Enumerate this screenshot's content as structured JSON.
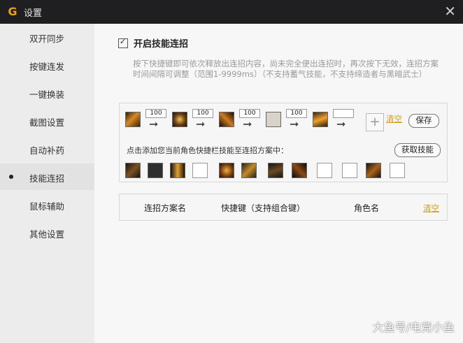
{
  "window": {
    "title": "设置",
    "close_glyph": "✕",
    "logo_glyph": "G"
  },
  "sidebar": {
    "items": [
      {
        "label": "双开同步"
      },
      {
        "label": "按键连发"
      },
      {
        "label": "一键换装"
      },
      {
        "label": "截图设置"
      },
      {
        "label": "自动补药"
      },
      {
        "label": "技能连招",
        "active": true
      },
      {
        "label": "鼠标辅助"
      },
      {
        "label": "其他设置"
      }
    ]
  },
  "main": {
    "enable_label": "开启技能连招",
    "enable_checked": true,
    "description": "按下快捷键即可依次释放出连招内容，尚未完全便出连招时，再次按下无效，连招方案时间间隔可调整（范围1-9999ms）（不支持蓄气技能，不支持缔造者与黑暗武士）",
    "sequence": {
      "delays": [
        "100",
        "100",
        "100",
        "100",
        ""
      ],
      "arrow_glyph": "➞",
      "plus_glyph": "+",
      "clear_label": "清空",
      "save_label": "保存"
    },
    "palette": {
      "hint": "点击添加您当前角色快捷栏技能至连招方案中：",
      "fetch_label": "获取技能"
    },
    "table": {
      "col_plan": "连招方案名",
      "col_hotkey": "快捷键（支持组合键）",
      "col_role": "角色名",
      "clear_label": "清空"
    }
  },
  "watermark": "大鱼号/电竞小鱼"
}
